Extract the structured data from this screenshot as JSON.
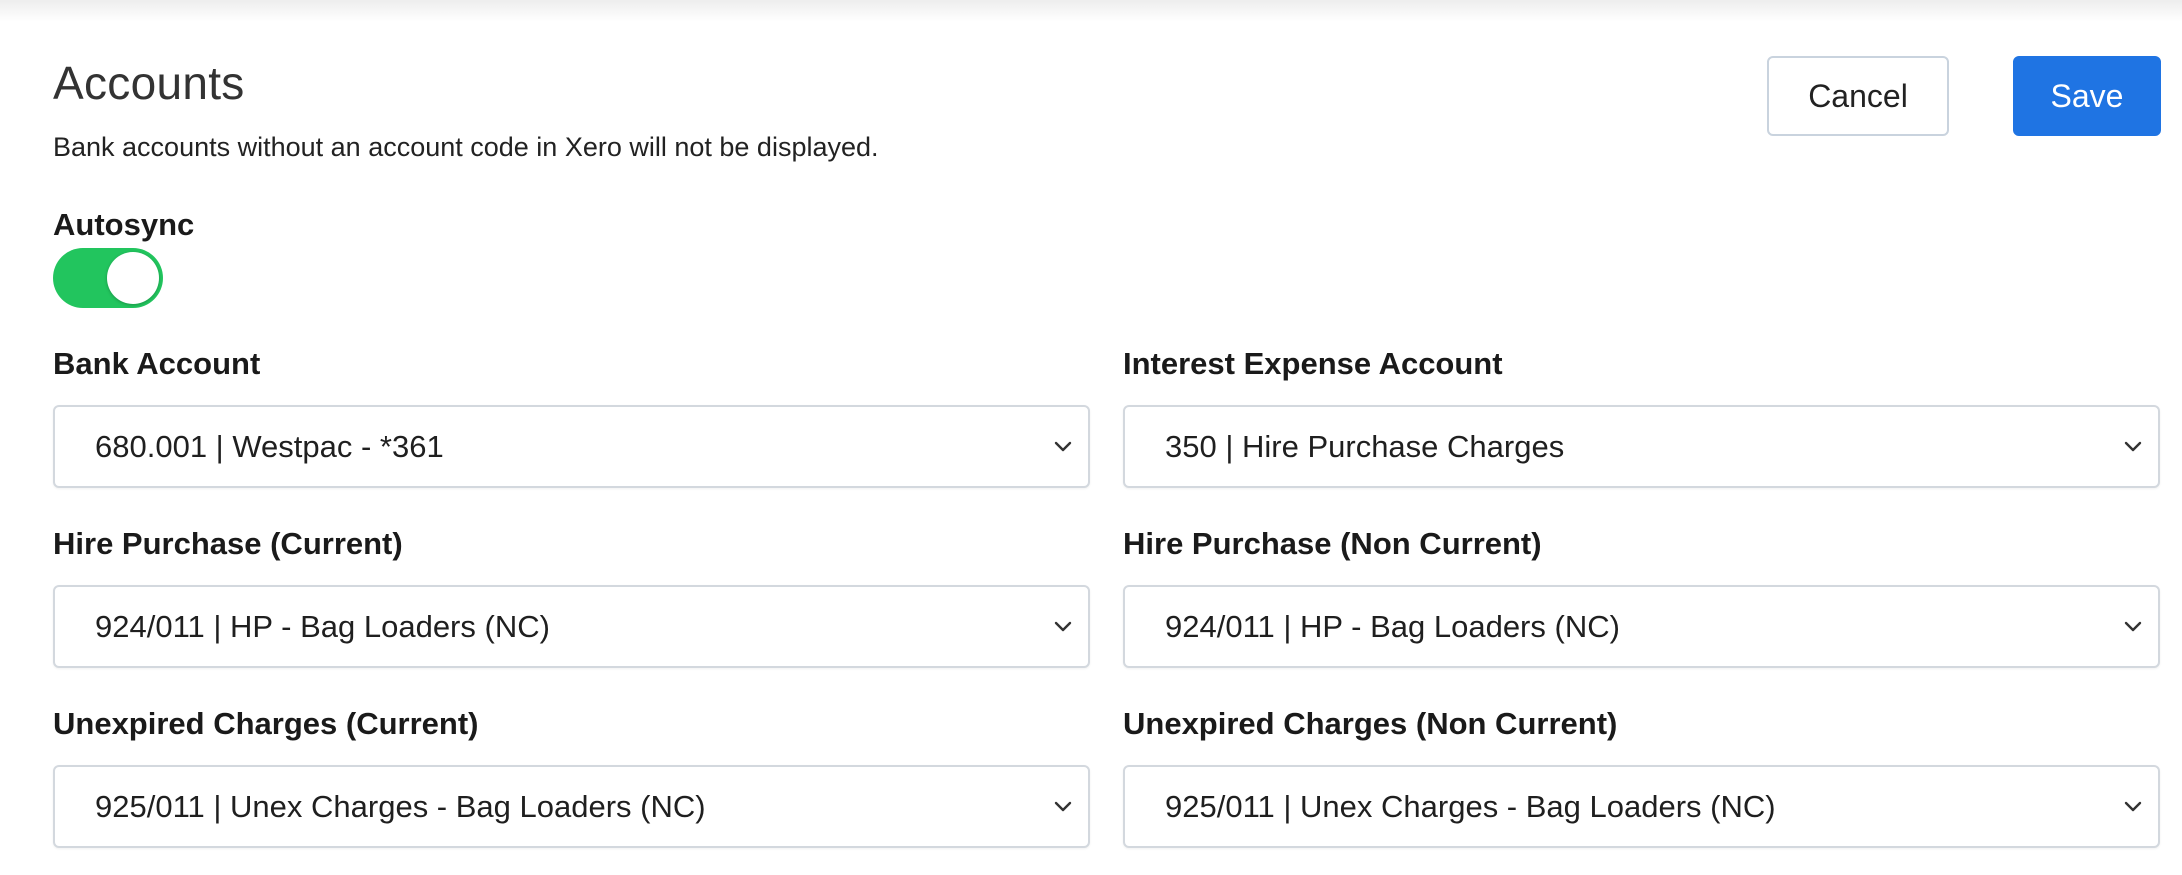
{
  "header": {
    "title": "Accounts",
    "subtitle": "Bank accounts without an account code in Xero will not be displayed."
  },
  "actions": {
    "cancel_label": "Cancel",
    "save_label": "Save"
  },
  "autosync": {
    "label": "Autosync",
    "enabled": true
  },
  "fields": {
    "bank_account": {
      "label": "Bank Account",
      "value": "680.001 | Westpac - *361"
    },
    "interest_expense_account": {
      "label": "Interest Expense Account",
      "value": "350 | Hire Purchase Charges"
    },
    "hire_purchase_current": {
      "label": "Hire Purchase (Current)",
      "value": "924/011 | HP - Bag Loaders (NC)"
    },
    "hire_purchase_non_current": {
      "label": "Hire Purchase (Non Current)",
      "value": "924/011 | HP - Bag Loaders (NC)"
    },
    "unexpired_charges_current": {
      "label": "Unexpired Charges (Current)",
      "value": "925/011 | Unex Charges - Bag Loaders (NC)"
    },
    "unexpired_charges_non_current": {
      "label": "Unexpired Charges (Non Current)",
      "value": "925/011 | Unex Charges - Bag Loaders (NC)"
    }
  },
  "icons": {
    "select_chevron": "chevron-down-icon"
  },
  "colors": {
    "primary": "#1f74e3",
    "toggle_on": "#22c55e",
    "border": "#d3d8de"
  }
}
